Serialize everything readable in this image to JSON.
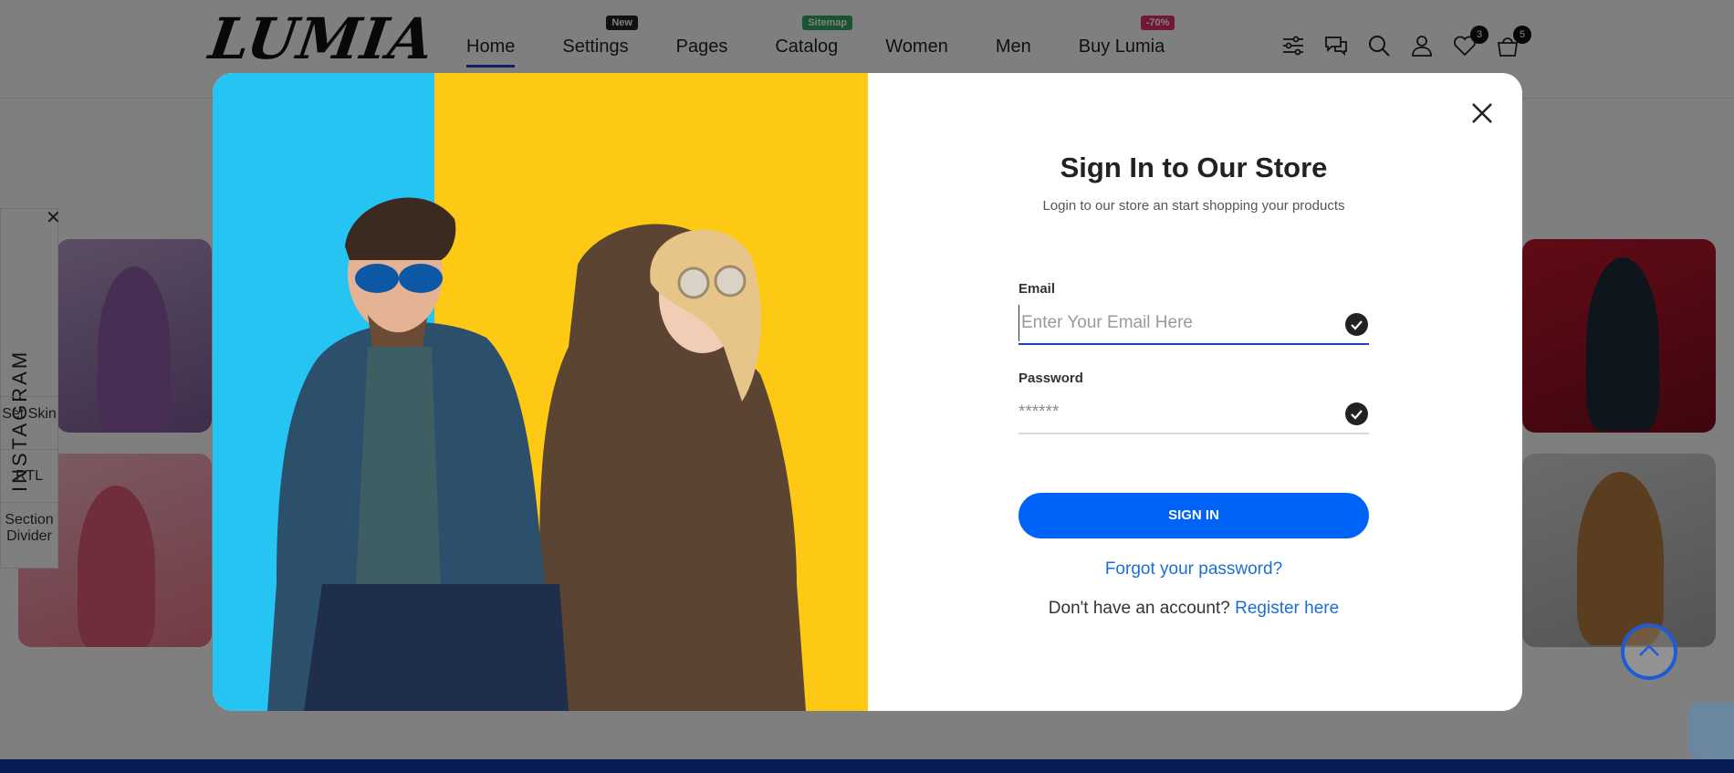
{
  "header": {
    "logo": "LUMIA",
    "nav": [
      {
        "label": "Home",
        "badge": ""
      },
      {
        "label": "Settings",
        "badge": "New"
      },
      {
        "label": "Pages",
        "badge": ""
      },
      {
        "label": "Catalog",
        "badge": "Sitemap"
      },
      {
        "label": "Women",
        "badge": ""
      },
      {
        "label": "Men",
        "badge": ""
      },
      {
        "label": "Buy Lumia",
        "badge": "-70%"
      }
    ],
    "icons": [
      "filter-icon",
      "chat-icon",
      "search-icon",
      "user-icon",
      "heart-icon",
      "bag-icon"
    ],
    "wishlist_count": "3",
    "cart_count": "5"
  },
  "side": {
    "instagram": "INSTAGRAM",
    "set_skin": "Set Skin",
    "rtl": "RTL",
    "section_divider": "Section Divider"
  },
  "modal": {
    "title": "Sign In to Our Store",
    "subtitle": "Login to our store an start shopping your products",
    "email_label": "Email",
    "email_placeholder": "Enter Your Email Here",
    "password_label": "Password",
    "password_value": "******",
    "signin_label": "SIGN IN",
    "forgot_label": "Forgot your password?",
    "no_account": "Don't have an account?",
    "register_label": "Register here"
  },
  "colors": {
    "accent": "#0063f7",
    "link": "#1a6fd6",
    "hero_yellow": "#fec915",
    "hero_blue": "#25c4f2"
  }
}
